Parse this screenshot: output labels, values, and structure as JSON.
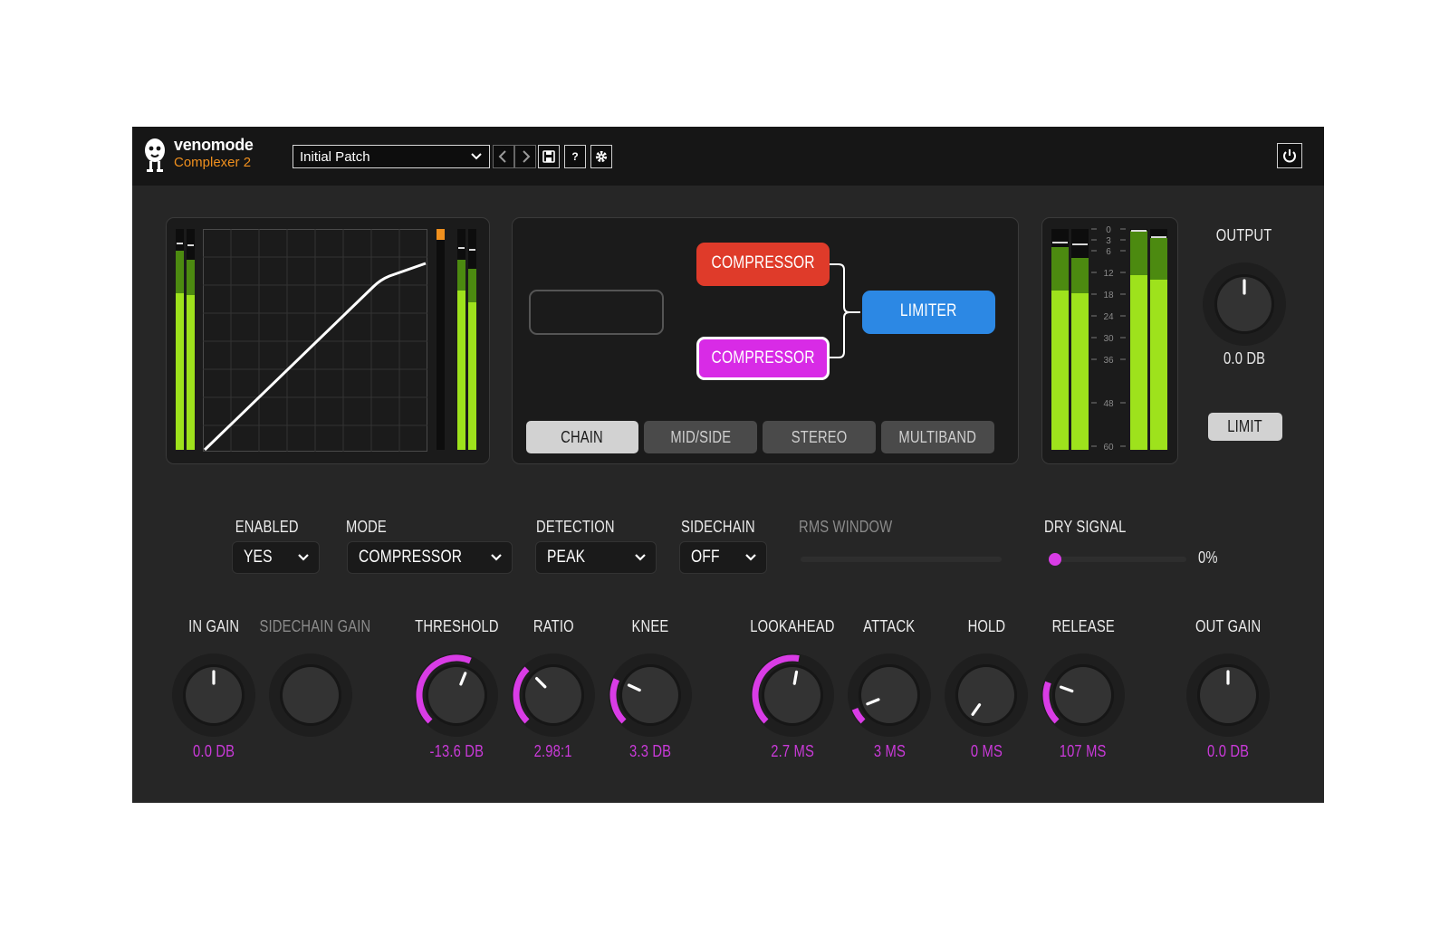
{
  "header": {
    "brand": "venomode",
    "product": "Complexer 2",
    "patch": {
      "value": "Initial Patch"
    },
    "icons": [
      "venomode-logo-icon",
      "chevron-down-icon",
      "chevron-left-icon",
      "chevron-right-icon",
      "save-icon",
      "help-icon",
      "gear-icon",
      "power-icon"
    ],
    "help_label": "?"
  },
  "colors": {
    "accent": "#d93ce6",
    "compressor_top": "#df3b2a",
    "compressor_bottom": "#d82be6",
    "limiter": "#2c88e4",
    "meter_green": "#9ee21c",
    "meter_dark_green": "#4c8a10",
    "orange": "#f0901e"
  },
  "routing": {
    "blocks": {
      "compressor_top": "COMPRESSOR",
      "compressor_bottom": "COMPRESSOR",
      "limiter": "LIMITER"
    },
    "tabs": [
      {
        "label": "CHAIN",
        "active": true
      },
      {
        "label": "MID/SIDE",
        "active": false
      },
      {
        "label": "STEREO",
        "active": false
      },
      {
        "label": "MULTIBAND",
        "active": false
      }
    ]
  },
  "meter_scale": [
    "0",
    "3",
    "6",
    "12",
    "18",
    "24",
    "30",
    "36",
    "48",
    "60"
  ],
  "output": {
    "label": "OUTPUT",
    "value": "0.0 DB",
    "limit_label": "LIMIT"
  },
  "controls": {
    "enabled": {
      "label": "ENABLED",
      "value": "YES"
    },
    "mode": {
      "label": "MODE",
      "value": "COMPRESSOR"
    },
    "detection": {
      "label": "DETECTION",
      "value": "PEAK"
    },
    "sidechain": {
      "label": "SIDECHAIN",
      "value": "OFF"
    },
    "rms_window": {
      "label": "RMS WINDOW"
    },
    "dry_signal": {
      "label": "DRY SIGNAL",
      "value": "0%",
      "level": 0
    }
  },
  "knobs": [
    {
      "key": "in_gain",
      "label": "IN GAIN",
      "value": "0.0 DB",
      "angle": 0,
      "arc": null
    },
    {
      "key": "sidechain_gain",
      "label": "SIDECHAIN GAIN",
      "value": "",
      "angle": null,
      "arc": null,
      "dim": true
    },
    {
      "key": "threshold",
      "label": "THRESHOLD",
      "value": "-13.6 DB",
      "angle": 22,
      "arc": [
        -135,
        22
      ]
    },
    {
      "key": "ratio",
      "label": "RATIO",
      "value": "2.98:1",
      "angle": -45,
      "arc": [
        -135,
        -45
      ]
    },
    {
      "key": "knee",
      "label": "KNEE",
      "value": "3.3 DB",
      "angle": -65,
      "arc": [
        -135,
        -65
      ]
    },
    {
      "key": "lookahead",
      "label": "LOOKAHEAD",
      "value": "2.7 MS",
      "angle": 10,
      "arc": [
        -135,
        10
      ]
    },
    {
      "key": "attack",
      "label": "ATTACK",
      "value": "3 MS",
      "angle": -112,
      "arc": [
        -135,
        -112
      ]
    },
    {
      "key": "hold",
      "label": "HOLD",
      "value": "0 MS",
      "angle": -145,
      "arc": null
    },
    {
      "key": "release",
      "label": "RELEASE",
      "value": "107 MS",
      "angle": -70,
      "arc": [
        -135,
        -70
      ]
    },
    {
      "key": "out_gain",
      "label": "OUT GAIN",
      "value": "0.0 DB",
      "angle": 0,
      "arc": null
    }
  ]
}
